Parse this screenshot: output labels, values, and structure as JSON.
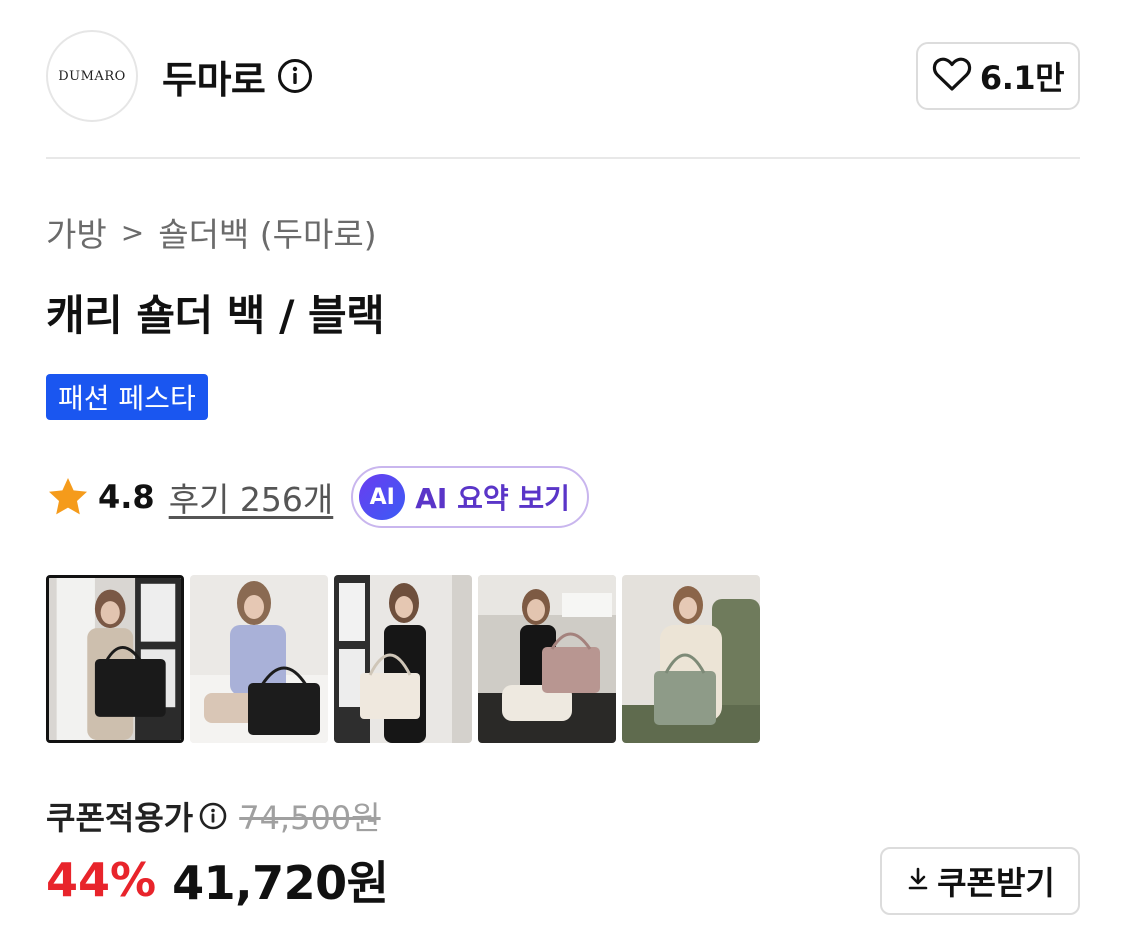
{
  "brand": {
    "logo_text": "DUMARO",
    "name": "두마로",
    "likes": "6.1만"
  },
  "breadcrumb": {
    "category": "가방",
    "separator": ">",
    "subcategory": "숄더백 (두마로)"
  },
  "product": {
    "title": "캐리 숄더 백 / 블랙",
    "badge": "패션 페스타",
    "badge_color": "#1a56f0"
  },
  "rating": {
    "score": "4.8",
    "reviews_label": "후기 256개",
    "ai_badge": "AI",
    "ai_summary_label": "AI 요약 보기"
  },
  "thumbnails": [
    {
      "name": "black-bag-model-window",
      "selected": true
    },
    {
      "name": "black-bag-model-sitting"
    },
    {
      "name": "cream-bag-model-window"
    },
    {
      "name": "pink-bag-model-sitting"
    },
    {
      "name": "grey-green-bag-model-sofa"
    }
  ],
  "pricing": {
    "coupon_label": "쿠폰적용가",
    "original_price": "74,500원",
    "discount": "44%",
    "final_price": "41,720원",
    "coupon_button": "쿠폰받기",
    "discount_color": "#e8242b"
  },
  "icons": {
    "info": "info-icon",
    "heart": "heart-icon",
    "star": "star-icon",
    "download": "download-icon"
  }
}
